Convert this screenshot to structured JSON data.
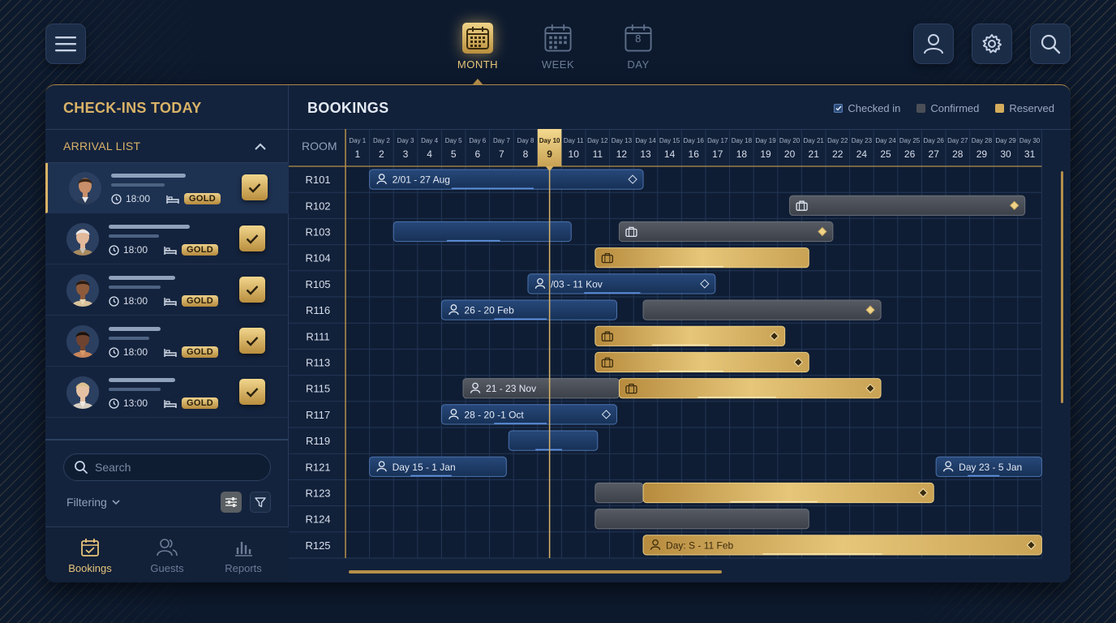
{
  "colors": {
    "gold": "#d9b367",
    "navy": "#12213a",
    "checked_in": "#1e3d6b",
    "confirmed": "#4a4f57",
    "reserved": "#c9a254"
  },
  "topbar": {
    "menu_icon": "menu-icon",
    "views": [
      {
        "label": "MONTH",
        "icon": "calendar-grid-icon",
        "active": true
      },
      {
        "label": "WEEK",
        "icon": "calendar-grid-icon",
        "active": false
      },
      {
        "label": "DAY",
        "icon": "calendar-day-icon",
        "day_number": "8",
        "active": false
      }
    ],
    "right_icons": [
      "user-icon",
      "gear-icon",
      "search-icon"
    ]
  },
  "sidebar": {
    "title": "CHECK-INS TODAY",
    "arrival_list_label": "ARRIVAL LIST",
    "arrivals": [
      {
        "time": "18:00",
        "badge": "GOLD",
        "selected": true,
        "checked": true
      },
      {
        "time": "18:00",
        "badge": "GOLD",
        "selected": false,
        "checked": true
      },
      {
        "time": "18:00",
        "badge": "GOLD",
        "selected": false,
        "checked": true
      },
      {
        "time": "18:00",
        "badge": "GOLD",
        "selected": false,
        "checked": true
      },
      {
        "time": "13:00",
        "badge": "GOLD",
        "selected": false,
        "checked": true
      }
    ],
    "search_placeholder": "Search",
    "filtering_label": "Filtering",
    "tabs": [
      {
        "label": "Bookings",
        "icon": "calendar-check-icon",
        "active": true
      },
      {
        "label": "Guests",
        "icon": "users-icon",
        "active": false
      },
      {
        "label": "Reports",
        "icon": "bar-chart-icon",
        "active": false
      }
    ]
  },
  "bookings": {
    "title": "BOOKINGS",
    "legend": [
      {
        "label": "Checked in",
        "key": "checked_in"
      },
      {
        "label": "Confirmed",
        "key": "confirmed"
      },
      {
        "label": "Reserved",
        "key": "reserved"
      }
    ],
    "room_header": "ROOM",
    "days": [
      {
        "label": "Day 1",
        "num": "1"
      },
      {
        "label": "Day 2",
        "num": "2"
      },
      {
        "label": "Day 3",
        "num": "3"
      },
      {
        "label": "Day 4",
        "num": "4"
      },
      {
        "label": "Day 5",
        "num": "5"
      },
      {
        "label": "Day 6",
        "num": "6"
      },
      {
        "label": "Day 7",
        "num": "7"
      },
      {
        "label": "Day 8",
        "num": "8"
      },
      {
        "label": "Day 10",
        "num": "9",
        "today": true
      },
      {
        "label": "Day 11",
        "num": "10"
      },
      {
        "label": "Day 12",
        "num": "11"
      },
      {
        "label": "Day 13",
        "num": "12"
      },
      {
        "label": "Day 14",
        "num": "13"
      },
      {
        "label": "Day 15",
        "num": "14"
      },
      {
        "label": "Day 16",
        "num": "16"
      },
      {
        "label": "Day 17",
        "num": "17"
      },
      {
        "label": "Day 18",
        "num": "18"
      },
      {
        "label": "Day 19",
        "num": "19"
      },
      {
        "label": "Day 20",
        "num": "20"
      },
      {
        "label": "Day 21",
        "num": "21"
      },
      {
        "label": "Day 22",
        "num": "22"
      },
      {
        "label": "Day 23",
        "num": "24"
      },
      {
        "label": "Day 24",
        "num": "25"
      },
      {
        "label": "Day 25",
        "num": "26"
      },
      {
        "label": "Day 26",
        "num": "27"
      },
      {
        "label": "Day 27",
        "num": "28"
      },
      {
        "label": "Day 28",
        "num": "29"
      },
      {
        "label": "Day 29",
        "num": "30"
      },
      {
        "label": "Day 30",
        "num": "31"
      }
    ],
    "rooms": [
      "R101",
      "R102",
      "R103",
      "R104",
      "R105",
      "R116",
      "R111",
      "R113",
      "R115",
      "R117",
      "R119",
      "R121",
      "R123",
      "R124",
      "R125"
    ],
    "bars": [
      {
        "row": 0,
        "start": 1,
        "end": 12.4,
        "status": "checked_in",
        "icon": "user-icon",
        "label": "2/01 - 27 Aug",
        "end_marker": true
      },
      {
        "row": 1,
        "start": 18.5,
        "end": 28.3,
        "status": "confirmed",
        "icon": "suitcase-icon",
        "end_marker": true
      },
      {
        "row": 2,
        "start": 2,
        "end": 9.4,
        "status": "checked_in"
      },
      {
        "row": 2,
        "start": 11.4,
        "end": 20.3,
        "status": "confirmed",
        "icon": "suitcase-icon",
        "end_marker": true
      },
      {
        "row": 3,
        "start": 10.4,
        "end": 19.3,
        "status": "reserved",
        "icon": "suitcase-icon"
      },
      {
        "row": 4,
        "start": 7.6,
        "end": 15.4,
        "status": "checked_in",
        "icon": "user-icon",
        "label": "/03 - 11 Kov",
        "end_marker": true
      },
      {
        "row": 5,
        "start": 4.0,
        "end": 11.3,
        "status": "checked_in",
        "icon": "user-icon",
        "label": "26 - 20 Feb"
      },
      {
        "row": 5,
        "start": 12.4,
        "end": 22.3,
        "status": "confirmed",
        "end_marker": true
      },
      {
        "row": 6,
        "start": 10.4,
        "end": 18.3,
        "status": "reserved",
        "icon": "suitcase-icon",
        "end_marker": true
      },
      {
        "row": 7,
        "start": 10.4,
        "end": 19.3,
        "status": "reserved",
        "icon": "suitcase-icon",
        "end_marker": true
      },
      {
        "row": 8,
        "start": 4.9,
        "end": 11.4,
        "status": "confirmed",
        "icon": "user-icon",
        "label": "21 - 23 Nov"
      },
      {
        "row": 8,
        "start": 11.4,
        "end": 22.3,
        "status": "reserved",
        "icon": "suitcase-icon",
        "end_marker": true
      },
      {
        "row": 9,
        "start": 4.0,
        "end": 11.3,
        "status": "checked_in",
        "icon": "user-icon",
        "label": "28 - 20 -1 Oct",
        "end_marker": true
      },
      {
        "row": 10,
        "start": 6.8,
        "end": 10.5,
        "status": "checked_in"
      },
      {
        "row": 11,
        "start": 1,
        "end": 6.7,
        "status": "checked_in",
        "icon": "user-icon",
        "label": "Day 15 - 1 Jan"
      },
      {
        "row": 11,
        "start": 24.6,
        "end": 29,
        "status": "checked_in",
        "icon": "user-icon",
        "label": "Day 23 - 5 Jan"
      },
      {
        "row": 12,
        "start": 10.4,
        "end": 12.4,
        "status": "confirmed"
      },
      {
        "row": 12,
        "start": 12.4,
        "end": 24.5,
        "status": "reserved",
        "end_marker": true
      },
      {
        "row": 13,
        "start": 10.4,
        "end": 19.3,
        "status": "confirmed"
      },
      {
        "row": 14,
        "start": 12.4,
        "end": 29,
        "status": "reserved",
        "icon": "user-icon",
        "label": "Day: S - 11 Feb",
        "end_marker": true
      }
    ],
    "today_col": 8
  }
}
